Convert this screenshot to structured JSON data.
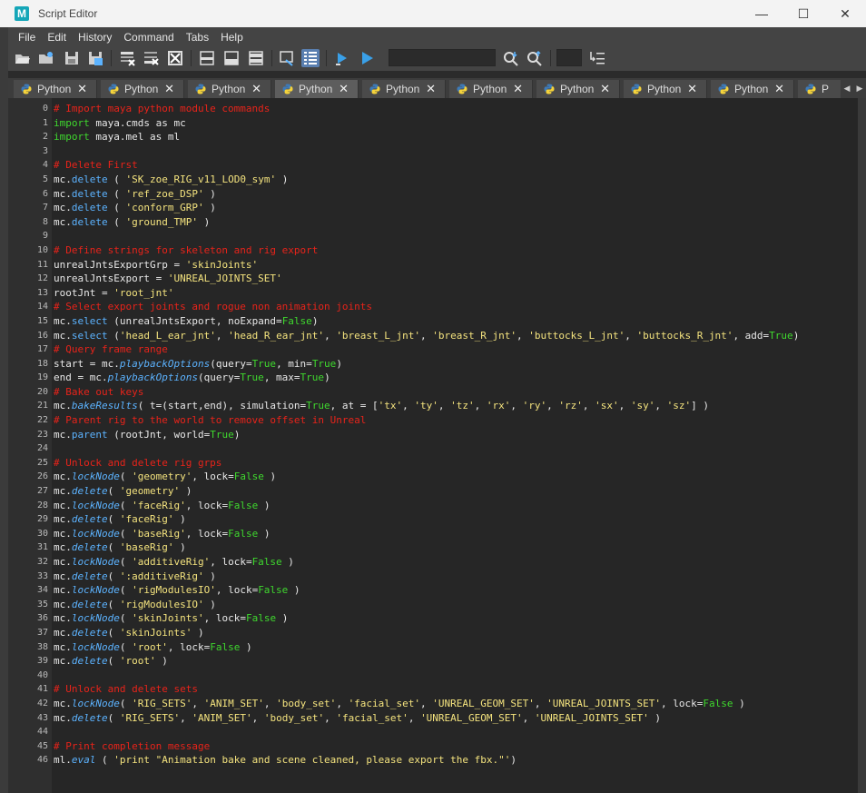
{
  "window": {
    "app_logo_letter": "M",
    "title": "Script Editor",
    "controls": [
      "—",
      "☐",
      "✕"
    ]
  },
  "menu": [
    "File",
    "Edit",
    "History",
    "Command",
    "Tabs",
    "Help"
  ],
  "toolbar": {
    "search_value": "",
    "font_size_value": ""
  },
  "tabs": [
    {
      "label": "Python",
      "active": false
    },
    {
      "label": "Python",
      "active": false
    },
    {
      "label": "Python",
      "active": false
    },
    {
      "label": "Python",
      "active": true
    },
    {
      "label": "Python",
      "active": false
    },
    {
      "label": "Python",
      "active": false
    },
    {
      "label": "Python",
      "active": false
    },
    {
      "label": "Python",
      "active": false
    },
    {
      "label": "Python",
      "active": false
    },
    {
      "label": "P",
      "active": false
    }
  ],
  "tab_close": "✕",
  "tab_scroll": [
    "◀",
    "▶"
  ],
  "colors": {
    "comment": "#e8231a",
    "keyword": "#3fd82e",
    "function": "#5cb3ff",
    "string": "#f4e37e",
    "text": "#e8e8e8",
    "editor_bg": "#262626"
  },
  "code_lines": [
    [
      [
        "c",
        "# Import maya python module commands"
      ]
    ],
    [
      [
        "k",
        "import"
      ],
      [
        "p",
        " maya.cmds as mc"
      ]
    ],
    [
      [
        "k",
        "import"
      ],
      [
        "p",
        " maya.mel as ml"
      ]
    ],
    [],
    [
      [
        "c",
        "# Delete First"
      ]
    ],
    [
      [
        "p",
        "mc."
      ],
      [
        "f",
        "delete"
      ],
      [
        "p",
        " ( "
      ],
      [
        "s",
        "'SK_zoe_RIG_v11_LOD0_sym'"
      ],
      [
        "p",
        " )"
      ]
    ],
    [
      [
        "p",
        "mc."
      ],
      [
        "f",
        "delete"
      ],
      [
        "p",
        " ( "
      ],
      [
        "s",
        "'ref_zoe_DSP'"
      ],
      [
        "p",
        " )"
      ]
    ],
    [
      [
        "p",
        "mc."
      ],
      [
        "f",
        "delete"
      ],
      [
        "p",
        " ( "
      ],
      [
        "s",
        "'conform_GRP'"
      ],
      [
        "p",
        " )"
      ]
    ],
    [
      [
        "p",
        "mc."
      ],
      [
        "f",
        "delete"
      ],
      [
        "p",
        " ( "
      ],
      [
        "s",
        "'ground_TMP'"
      ],
      [
        "p",
        " )"
      ]
    ],
    [],
    [
      [
        "c",
        "# Define strings for skeleton and rig export"
      ]
    ],
    [
      [
        "p",
        "unrealJntsExportGrp = "
      ],
      [
        "s",
        "'skinJoints'"
      ]
    ],
    [
      [
        "p",
        "unrealJntsExport = "
      ],
      [
        "s",
        "'UNREAL_JOINTS_SET'"
      ]
    ],
    [
      [
        "p",
        "rootJnt = "
      ],
      [
        "s",
        "'root_jnt'"
      ]
    ],
    [
      [
        "c",
        "# Select export joints and rogue non animation joints"
      ]
    ],
    [
      [
        "p",
        "mc."
      ],
      [
        "f",
        "select"
      ],
      [
        "p",
        " (unrealJntsExport, noExpand="
      ],
      [
        "b",
        "False"
      ],
      [
        "p",
        ")"
      ]
    ],
    [
      [
        "p",
        "mc."
      ],
      [
        "f",
        "select"
      ],
      [
        "p",
        " ("
      ],
      [
        "s",
        "'head_L_ear_jnt'"
      ],
      [
        "p",
        ", "
      ],
      [
        "s",
        "'head_R_ear_jnt'"
      ],
      [
        "p",
        ", "
      ],
      [
        "s",
        "'breast_L_jnt'"
      ],
      [
        "p",
        ", "
      ],
      [
        "s",
        "'breast_R_jnt'"
      ],
      [
        "p",
        ", "
      ],
      [
        "s",
        "'buttocks_L_jnt'"
      ],
      [
        "p",
        ", "
      ],
      [
        "s",
        "'buttocks_R_jnt'"
      ],
      [
        "p",
        ", add="
      ],
      [
        "b",
        "True"
      ],
      [
        "p",
        ")"
      ]
    ],
    [
      [
        "c",
        "# Query frame range"
      ]
    ],
    [
      [
        "p",
        "start = mc."
      ],
      [
        "i",
        "playbackOptions"
      ],
      [
        "p",
        "(query="
      ],
      [
        "b",
        "True"
      ],
      [
        "p",
        ", min="
      ],
      [
        "b",
        "True"
      ],
      [
        "p",
        ")"
      ]
    ],
    [
      [
        "p",
        "end = mc."
      ],
      [
        "i",
        "playbackOptions"
      ],
      [
        "p",
        "(query="
      ],
      [
        "b",
        "True"
      ],
      [
        "p",
        ", max="
      ],
      [
        "b",
        "True"
      ],
      [
        "p",
        ")"
      ]
    ],
    [
      [
        "c",
        "# Bake out keys"
      ]
    ],
    [
      [
        "p",
        "mc."
      ],
      [
        "i",
        "bakeResults"
      ],
      [
        "p",
        "( t=(start,end), simulation="
      ],
      [
        "b",
        "True"
      ],
      [
        "p",
        ", at = ["
      ],
      [
        "s",
        "'tx'"
      ],
      [
        "p",
        ", "
      ],
      [
        "s",
        "'ty'"
      ],
      [
        "p",
        ", "
      ],
      [
        "s",
        "'tz'"
      ],
      [
        "p",
        ", "
      ],
      [
        "s",
        "'rx'"
      ],
      [
        "p",
        ", "
      ],
      [
        "s",
        "'ry'"
      ],
      [
        "p",
        ", "
      ],
      [
        "s",
        "'rz'"
      ],
      [
        "p",
        ", "
      ],
      [
        "s",
        "'sx'"
      ],
      [
        "p",
        ", "
      ],
      [
        "s",
        "'sy'"
      ],
      [
        "p",
        ", "
      ],
      [
        "s",
        "'sz'"
      ],
      [
        "p",
        "] )"
      ]
    ],
    [
      [
        "c",
        "# Parent rig to the world to remove offset in Unreal"
      ]
    ],
    [
      [
        "p",
        "mc."
      ],
      [
        "f",
        "parent"
      ],
      [
        "p",
        " (rootJnt, world="
      ],
      [
        "b",
        "True"
      ],
      [
        "p",
        ")"
      ]
    ],
    [],
    [
      [
        "c",
        "# Unlock and delete rig grps"
      ]
    ],
    [
      [
        "p",
        "mc."
      ],
      [
        "i",
        "lockNode"
      ],
      [
        "p",
        "( "
      ],
      [
        "s",
        "'geometry'"
      ],
      [
        "p",
        ", lock="
      ],
      [
        "b",
        "False"
      ],
      [
        "p",
        " )"
      ]
    ],
    [
      [
        "p",
        "mc."
      ],
      [
        "i",
        "delete"
      ],
      [
        "p",
        "( "
      ],
      [
        "s",
        "'geometry'"
      ],
      [
        "p",
        " )"
      ]
    ],
    [
      [
        "p",
        "mc."
      ],
      [
        "i",
        "lockNode"
      ],
      [
        "p",
        "( "
      ],
      [
        "s",
        "'faceRig'"
      ],
      [
        "p",
        ", lock="
      ],
      [
        "b",
        "False"
      ],
      [
        "p",
        " )"
      ]
    ],
    [
      [
        "p",
        "mc."
      ],
      [
        "i",
        "delete"
      ],
      [
        "p",
        "( "
      ],
      [
        "s",
        "'faceRig'"
      ],
      [
        "p",
        " )"
      ]
    ],
    [
      [
        "p",
        "mc."
      ],
      [
        "i",
        "lockNode"
      ],
      [
        "p",
        "( "
      ],
      [
        "s",
        "'baseRig'"
      ],
      [
        "p",
        ", lock="
      ],
      [
        "b",
        "False"
      ],
      [
        "p",
        " )"
      ]
    ],
    [
      [
        "p",
        "mc."
      ],
      [
        "i",
        "delete"
      ],
      [
        "p",
        "( "
      ],
      [
        "s",
        "'baseRig'"
      ],
      [
        "p",
        " )"
      ]
    ],
    [
      [
        "p",
        "mc."
      ],
      [
        "i",
        "lockNode"
      ],
      [
        "p",
        "( "
      ],
      [
        "s",
        "'additiveRig'"
      ],
      [
        "p",
        ", lock="
      ],
      [
        "b",
        "False"
      ],
      [
        "p",
        " )"
      ]
    ],
    [
      [
        "p",
        "mc."
      ],
      [
        "i",
        "delete"
      ],
      [
        "p",
        "( "
      ],
      [
        "s",
        "':additiveRig'"
      ],
      [
        "p",
        " )"
      ]
    ],
    [
      [
        "p",
        "mc."
      ],
      [
        "i",
        "lockNode"
      ],
      [
        "p",
        "( "
      ],
      [
        "s",
        "'rigModulesIO'"
      ],
      [
        "p",
        ", lock="
      ],
      [
        "b",
        "False"
      ],
      [
        "p",
        " )"
      ]
    ],
    [
      [
        "p",
        "mc."
      ],
      [
        "i",
        "delete"
      ],
      [
        "p",
        "( "
      ],
      [
        "s",
        "'rigModulesIO'"
      ],
      [
        "p",
        " )"
      ]
    ],
    [
      [
        "p",
        "mc."
      ],
      [
        "i",
        "lockNode"
      ],
      [
        "p",
        "( "
      ],
      [
        "s",
        "'skinJoints'"
      ],
      [
        "p",
        ", lock="
      ],
      [
        "b",
        "False"
      ],
      [
        "p",
        " )"
      ]
    ],
    [
      [
        "p",
        "mc."
      ],
      [
        "i",
        "delete"
      ],
      [
        "p",
        "( "
      ],
      [
        "s",
        "'skinJoints'"
      ],
      [
        "p",
        " )"
      ]
    ],
    [
      [
        "p",
        "mc."
      ],
      [
        "i",
        "lockNode"
      ],
      [
        "p",
        "( "
      ],
      [
        "s",
        "'root'"
      ],
      [
        "p",
        ", lock="
      ],
      [
        "b",
        "False"
      ],
      [
        "p",
        " )"
      ]
    ],
    [
      [
        "p",
        "mc."
      ],
      [
        "i",
        "delete"
      ],
      [
        "p",
        "( "
      ],
      [
        "s",
        "'root'"
      ],
      [
        "p",
        " )"
      ]
    ],
    [],
    [
      [
        "c",
        "# Unlock and delete sets"
      ]
    ],
    [
      [
        "p",
        "mc."
      ],
      [
        "i",
        "lockNode"
      ],
      [
        "p",
        "( "
      ],
      [
        "s",
        "'RIG_SETS'"
      ],
      [
        "p",
        ", "
      ],
      [
        "s",
        "'ANIM_SET'"
      ],
      [
        "p",
        ", "
      ],
      [
        "s",
        "'body_set'"
      ],
      [
        "p",
        ", "
      ],
      [
        "s",
        "'facial_set'"
      ],
      [
        "p",
        ", "
      ],
      [
        "s",
        "'UNREAL_GEOM_SET'"
      ],
      [
        "p",
        ", "
      ],
      [
        "s",
        "'UNREAL_JOINTS_SET'"
      ],
      [
        "p",
        ", lock="
      ],
      [
        "b",
        "False"
      ],
      [
        "p",
        " )"
      ]
    ],
    [
      [
        "p",
        "mc."
      ],
      [
        "i",
        "delete"
      ],
      [
        "p",
        "( "
      ],
      [
        "s",
        "'RIG_SETS'"
      ],
      [
        "p",
        ", "
      ],
      [
        "s",
        "'ANIM_SET'"
      ],
      [
        "p",
        ", "
      ],
      [
        "s",
        "'body_set'"
      ],
      [
        "p",
        ", "
      ],
      [
        "s",
        "'facial_set'"
      ],
      [
        "p",
        ", "
      ],
      [
        "s",
        "'UNREAL_GEOM_SET'"
      ],
      [
        "p",
        ", "
      ],
      [
        "s",
        "'UNREAL_JOINTS_SET'"
      ],
      [
        "p",
        " )"
      ]
    ],
    [],
    [
      [
        "c",
        "# Print completion message"
      ]
    ],
    [
      [
        "p",
        "ml."
      ],
      [
        "i",
        "eval"
      ],
      [
        "p",
        " ( "
      ],
      [
        "s",
        "'print \"Animation bake and scene cleaned, please export the fbx.\"'"
      ],
      [
        "p",
        ")"
      ]
    ]
  ]
}
